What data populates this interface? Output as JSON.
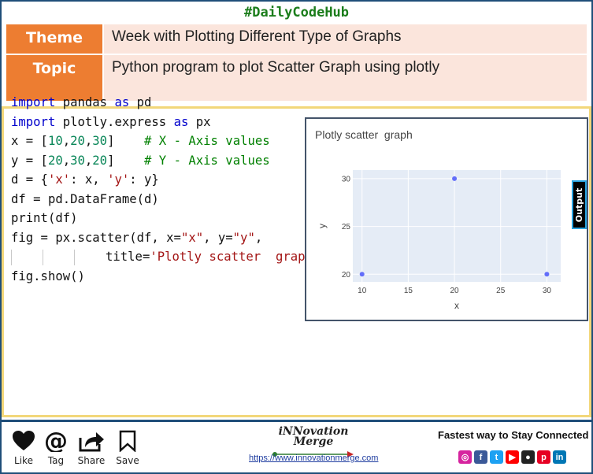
{
  "header": {
    "hashtag": "#DailyCodeHub",
    "theme_label": "Theme",
    "theme_value": "Week with Plotting Different Type of Graphs",
    "topic_label": "Topic",
    "topic_value": "Python program to plot Scatter Graph using plotly"
  },
  "code": {
    "lines": [
      "import pandas as pd",
      "import plotly.express as px",
      "x = [10,20,30]    # X - Axis values",
      "y = [20,30,20]    # Y - Axis values",
      "d = {'x': x, 'y': y}",
      "df = pd.DataFrame(d)",
      "print(df)",
      "fig = px.scatter(df, x=\"x\", y=\"y\",",
      "title='Plotly scatter  graph')",
      "fig.show()"
    ]
  },
  "output_tab": "Output",
  "chart_data": {
    "type": "scatter",
    "title": "Plotly scatter  graph",
    "xlabel": "x",
    "ylabel": "y",
    "x": [
      10,
      20,
      30
    ],
    "y": [
      20,
      30,
      20
    ],
    "xlim": [
      9,
      31.5
    ],
    "ylim": [
      19.2,
      30.9
    ],
    "xticks": [
      10,
      15,
      20,
      25,
      30
    ],
    "yticks": [
      20,
      25,
      30
    ],
    "grid": true,
    "colors": {
      "marker": "#636efa",
      "plot_bg": "#e5ecf6",
      "grid": "#ffffff",
      "text": "#444444"
    }
  },
  "footer": {
    "actions": [
      {
        "label": "Like",
        "icon": "heart-icon"
      },
      {
        "label": "Tag",
        "icon": "at-icon"
      },
      {
        "label": "Share",
        "icon": "share-icon"
      },
      {
        "label": "Save",
        "icon": "bookmark-icon"
      }
    ],
    "logo": "iNNovation Merge",
    "url": "https://www.innovationmerge.com",
    "tagline": "Fastest way to Stay Connected",
    "socials": [
      {
        "icon": "instagram-icon",
        "glyph": "◎",
        "color": "#d6249f"
      },
      {
        "icon": "facebook-icon",
        "glyph": "f",
        "color": "#3b5998"
      },
      {
        "icon": "twitter-icon",
        "glyph": "t",
        "color": "#1da1f2"
      },
      {
        "icon": "youtube-icon",
        "glyph": "▶",
        "color": "#ff0000"
      },
      {
        "icon": "github-icon",
        "glyph": "●",
        "color": "#222222"
      },
      {
        "icon": "pinterest-icon",
        "glyph": "p",
        "color": "#e60023"
      },
      {
        "icon": "linkedin-icon",
        "glyph": "in",
        "color": "#0077b5"
      }
    ]
  }
}
